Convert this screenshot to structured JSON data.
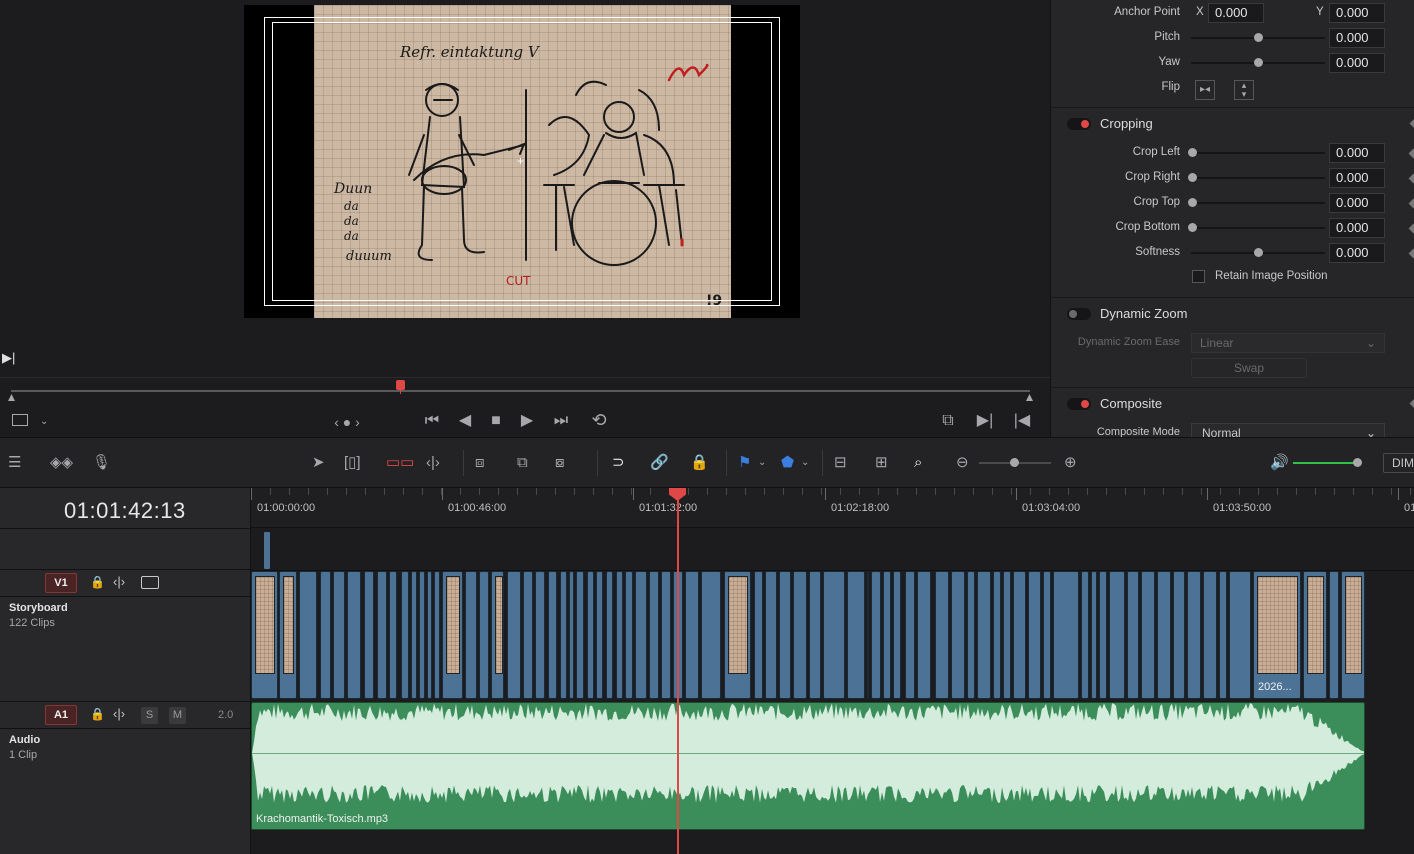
{
  "viewer": {
    "sketch_texts": [
      "Refr. eintaktung  V",
      "Duun",
      "da",
      "da",
      "da",
      "duuum",
      "CUT",
      "!9"
    ]
  },
  "transport": {
    "icons": [
      "jump-start-icon",
      "reverse-play-icon",
      "stop-icon",
      "play-icon",
      "jump-end-icon",
      "loop-icon"
    ]
  },
  "inspector": {
    "anchor_point": {
      "label": "Anchor Point",
      "x_label": "X",
      "x_value": "0.000",
      "y_label": "Y",
      "y_value": "0.000"
    },
    "pitch": {
      "label": "Pitch",
      "value": "0.000"
    },
    "yaw": {
      "label": "Yaw",
      "value": "0.000"
    },
    "flip": {
      "label": "Flip"
    },
    "cropping": {
      "title": "Cropping",
      "crop_left": {
        "label": "Crop Left",
        "value": "0.000"
      },
      "crop_right": {
        "label": "Crop Right",
        "value": "0.000"
      },
      "crop_top": {
        "label": "Crop Top",
        "value": "0.000"
      },
      "crop_bottom": {
        "label": "Crop Bottom",
        "value": "0.000"
      },
      "softness": {
        "label": "Softness",
        "value": "0.000"
      },
      "retain": "Retain Image Position"
    },
    "dynamic_zoom": {
      "title": "Dynamic Zoom",
      "ease_label": "Dynamic Zoom Ease",
      "ease_value": "Linear",
      "swap": "Swap"
    },
    "composite": {
      "title": "Composite",
      "mode_label": "Composite Mode",
      "mode_value": "Normal"
    }
  },
  "toolbar": {
    "dim": "DIM"
  },
  "timeline": {
    "timecode": "01:01:42:13",
    "ruler_labels": [
      "01:00:00:00",
      "01:00:46:00",
      "01:01:32:00",
      "01:02:18:00",
      "01:03:04:00",
      "01:03:50:00",
      "01"
    ],
    "v1": {
      "badge": "V1",
      "name": "Storyboard",
      "sub": "122 Clips",
      "last_clip_label": "2026..."
    },
    "a1": {
      "badge": "A1",
      "solo": "S",
      "mute": "M",
      "channels": "2.0",
      "name": "Audio",
      "sub": "1 Clip",
      "clip_name": "Krachomantik-Toxisch.mp3"
    }
  },
  "colors": {
    "accent_red": "#e04848",
    "video_clip": "#4c7396",
    "audio_clip": "#3b8e5a",
    "audio_wave": "#d4ecdc"
  }
}
